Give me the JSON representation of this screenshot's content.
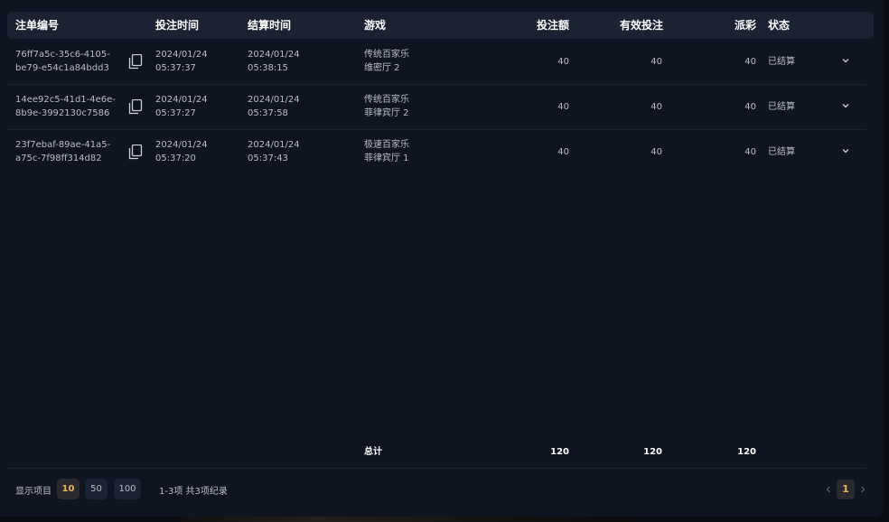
{
  "table": {
    "headers": {
      "order_id": "注单编号",
      "bet_time": "投注时间",
      "settle_time": "结算时间",
      "game": "游戏",
      "bet_amount": "投注额",
      "valid_bet": "有效投注",
      "payout": "派彩",
      "status": "状态"
    },
    "rows": [
      {
        "order_id_1": "76ff7a5c-35c6-4105-",
        "order_id_2": "be79-e54c1a84bdd3",
        "bet_date": "2024/01/24",
        "bet_clock": "05:37:37",
        "settle_date": "2024/01/24",
        "settle_clock": "05:38:15",
        "game_1": "传统百家乐",
        "game_2": "维密厅 2",
        "bet_amount": "40",
        "valid_bet": "40",
        "payout": "40",
        "status": "已结算"
      },
      {
        "order_id_1": "14ee92c5-41d1-4e6e-",
        "order_id_2": "8b9e-3992130c7586",
        "bet_date": "2024/01/24",
        "bet_clock": "05:37:27",
        "settle_date": "2024/01/24",
        "settle_clock": "05:37:58",
        "game_1": "传统百家乐",
        "game_2": "菲律宾厅 2",
        "bet_amount": "40",
        "valid_bet": "40",
        "payout": "40",
        "status": "已结算"
      },
      {
        "order_id_1": "23f7ebaf-89ae-41a5-",
        "order_id_2": "a75c-7f98ff314d82",
        "bet_date": "2024/01/24",
        "bet_clock": "05:37:20",
        "settle_date": "2024/01/24",
        "settle_clock": "05:37:43",
        "game_1": "极速百家乐",
        "game_2": "菲律宾厅 1",
        "bet_amount": "40",
        "valid_bet": "40",
        "payout": "40",
        "status": "已结算"
      }
    ],
    "totals": {
      "label": "总计",
      "bet_amount": "120",
      "valid_bet": "120",
      "payout": "120"
    }
  },
  "footer": {
    "page_size_label": "显示项目",
    "page_sizes": [
      "10",
      "50",
      "100"
    ],
    "selected_page_size": "10",
    "summary": "1-3项 共3项纪录",
    "current_page": "1"
  },
  "icons": {
    "copy": "copy-icon",
    "expand": "chevron-down-icon",
    "prev": "chevron-left-icon",
    "next": "chevron-right-icon"
  },
  "colors": {
    "panel_bg": "#0f1421",
    "header_bg": "#1b2232",
    "accent": "#e7b65a"
  }
}
